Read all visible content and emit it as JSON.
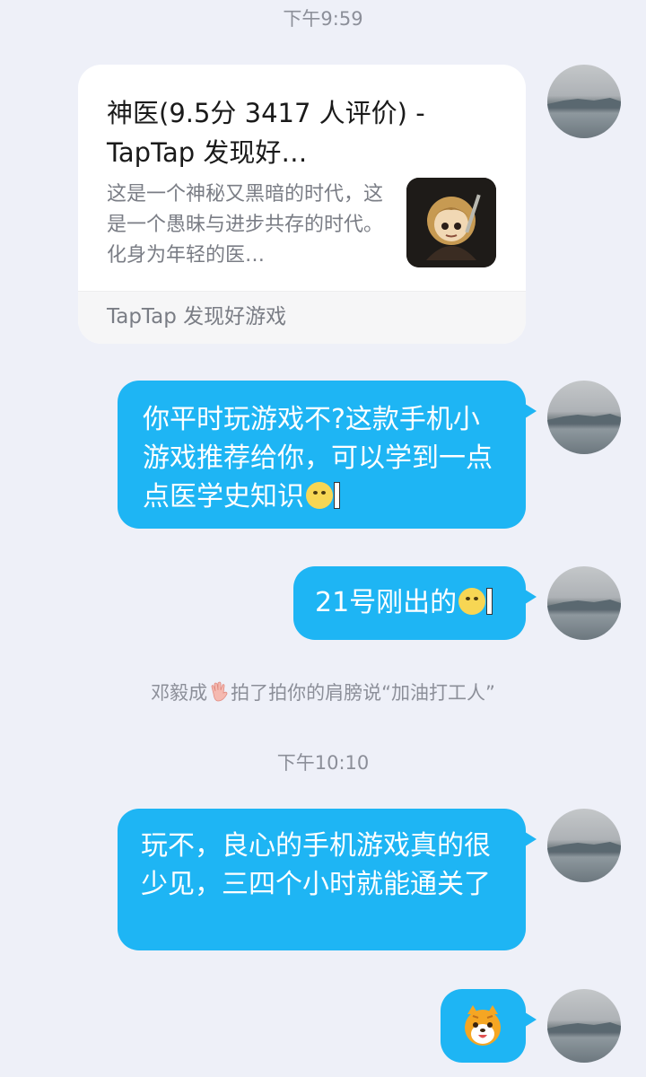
{
  "timestamps": [
    "下午9:59",
    "下午10:10"
  ],
  "link_card": {
    "title": "神医(9.5分 3417 人评价) - TapTap 发现好…",
    "description": "这是一个神秘又黑暗的时代，这是一个愚昧与进步共存的时代。化身为年轻的医…",
    "thumbnail": "game-character-icon",
    "source": "TapTap 发现好游戏"
  },
  "messages": [
    {
      "text": "你平时玩游戏不?这款手机小游戏推荐给你，可以学到一点点医学史知识",
      "emoji": "peek-emoji"
    },
    {
      "text": "21号刚出的",
      "emoji": "peek-emoji"
    },
    {
      "text": "玩不，良心的手机游戏真的很少见，三四个小时就能通关了"
    },
    {
      "emoji": "cat-sticker"
    }
  ],
  "system_notice": {
    "name": "邓毅成",
    "icon": "waving-hand-icon",
    "text": "拍了拍你的肩膀说“加油打工人”"
  },
  "colors": {
    "background": "#eef0f8",
    "bubble": "#1eb5f4",
    "card": "#ffffff"
  }
}
